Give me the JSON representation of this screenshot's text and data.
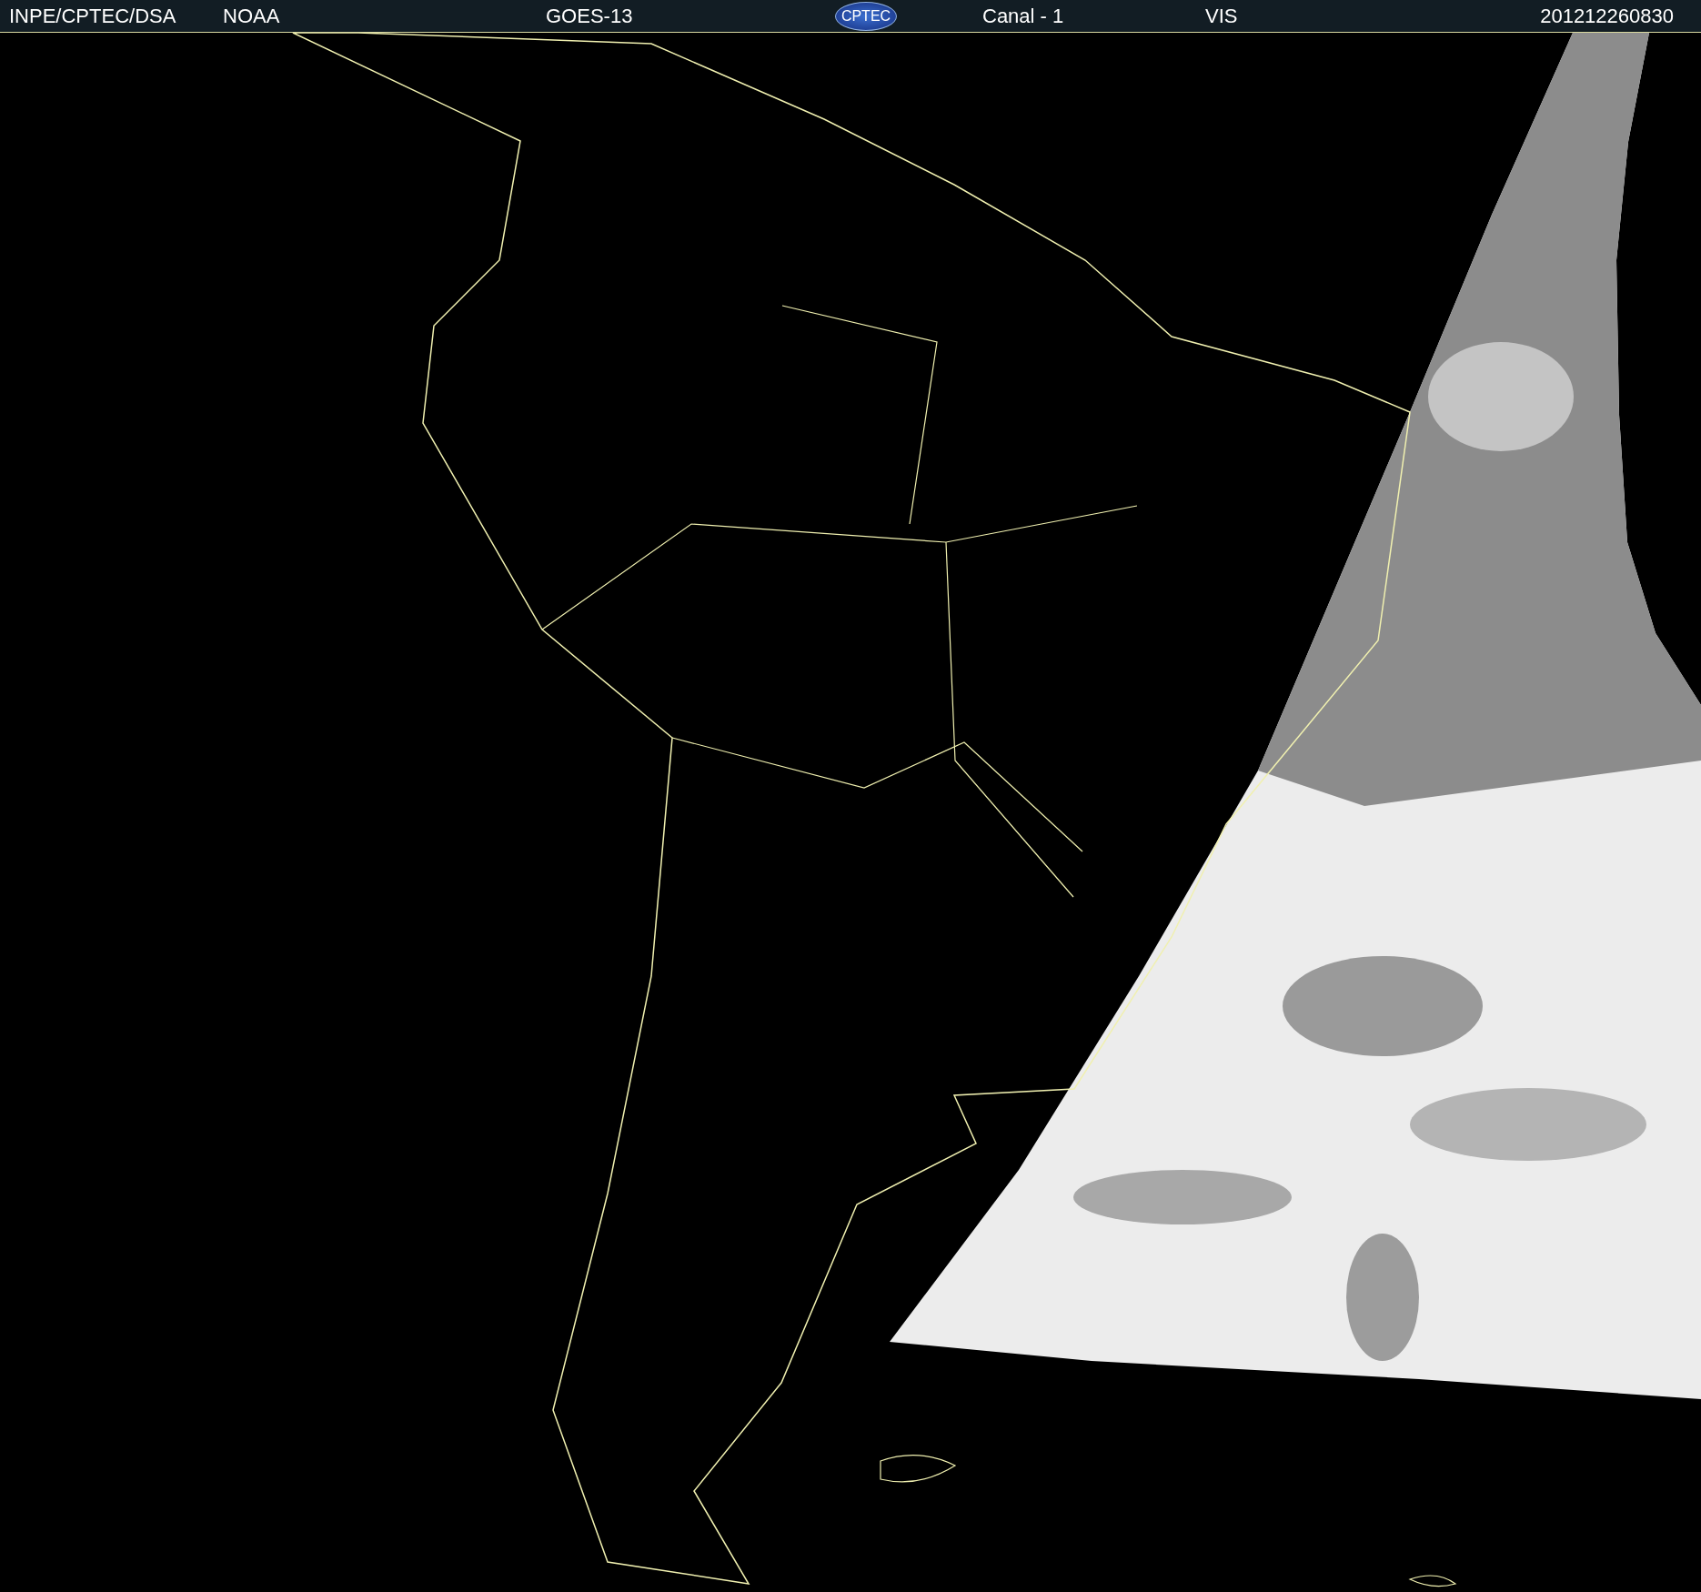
{
  "header": {
    "source": "INPE/CPTEC/DSA",
    "agency": "NOAA",
    "satellite": "GOES-13",
    "logo": "CPTEC",
    "channel": "Canal - 1",
    "band": "VIS",
    "timestamp": "201212260830"
  }
}
